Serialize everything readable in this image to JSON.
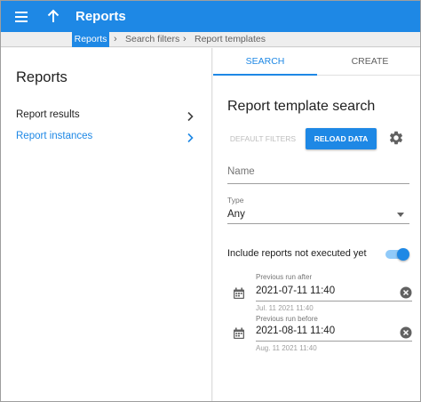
{
  "colors": {
    "primary": "#1e88e5",
    "primary_light": "#90caf9",
    "text": "#212121",
    "muted": "#757575"
  },
  "appbar": {
    "title": "Reports",
    "menu_icon": "menu-icon",
    "up_icon": "arrow-up-icon"
  },
  "breadcrumb": {
    "items": [
      "Reports",
      "Search filters",
      "Report templates"
    ]
  },
  "sidebar": {
    "heading": "Reports",
    "items": [
      {
        "label": "Report results",
        "active": false
      },
      {
        "label": "Report instances",
        "active": true
      }
    ]
  },
  "tabs": [
    {
      "label": "SEARCH",
      "active": true
    },
    {
      "label": "CREATE",
      "active": false
    }
  ],
  "search": {
    "title": "Report template search",
    "default_filters_label": "DEFAULT FILTERS",
    "reload_label": "RELOAD DATA",
    "name_placeholder": "Name",
    "type_label": "Type",
    "type_value": "Any",
    "include_label": "Include reports not executed yet",
    "include_enabled": true,
    "run_after": {
      "label": "Previous run after",
      "value": "2021-07-11 11:40",
      "hint": "Jul. 11 2021 11:40"
    },
    "run_before": {
      "label": "Previous run before",
      "value": "2021-08-11 11:40",
      "hint": "Aug. 11 2021 11:40"
    }
  }
}
